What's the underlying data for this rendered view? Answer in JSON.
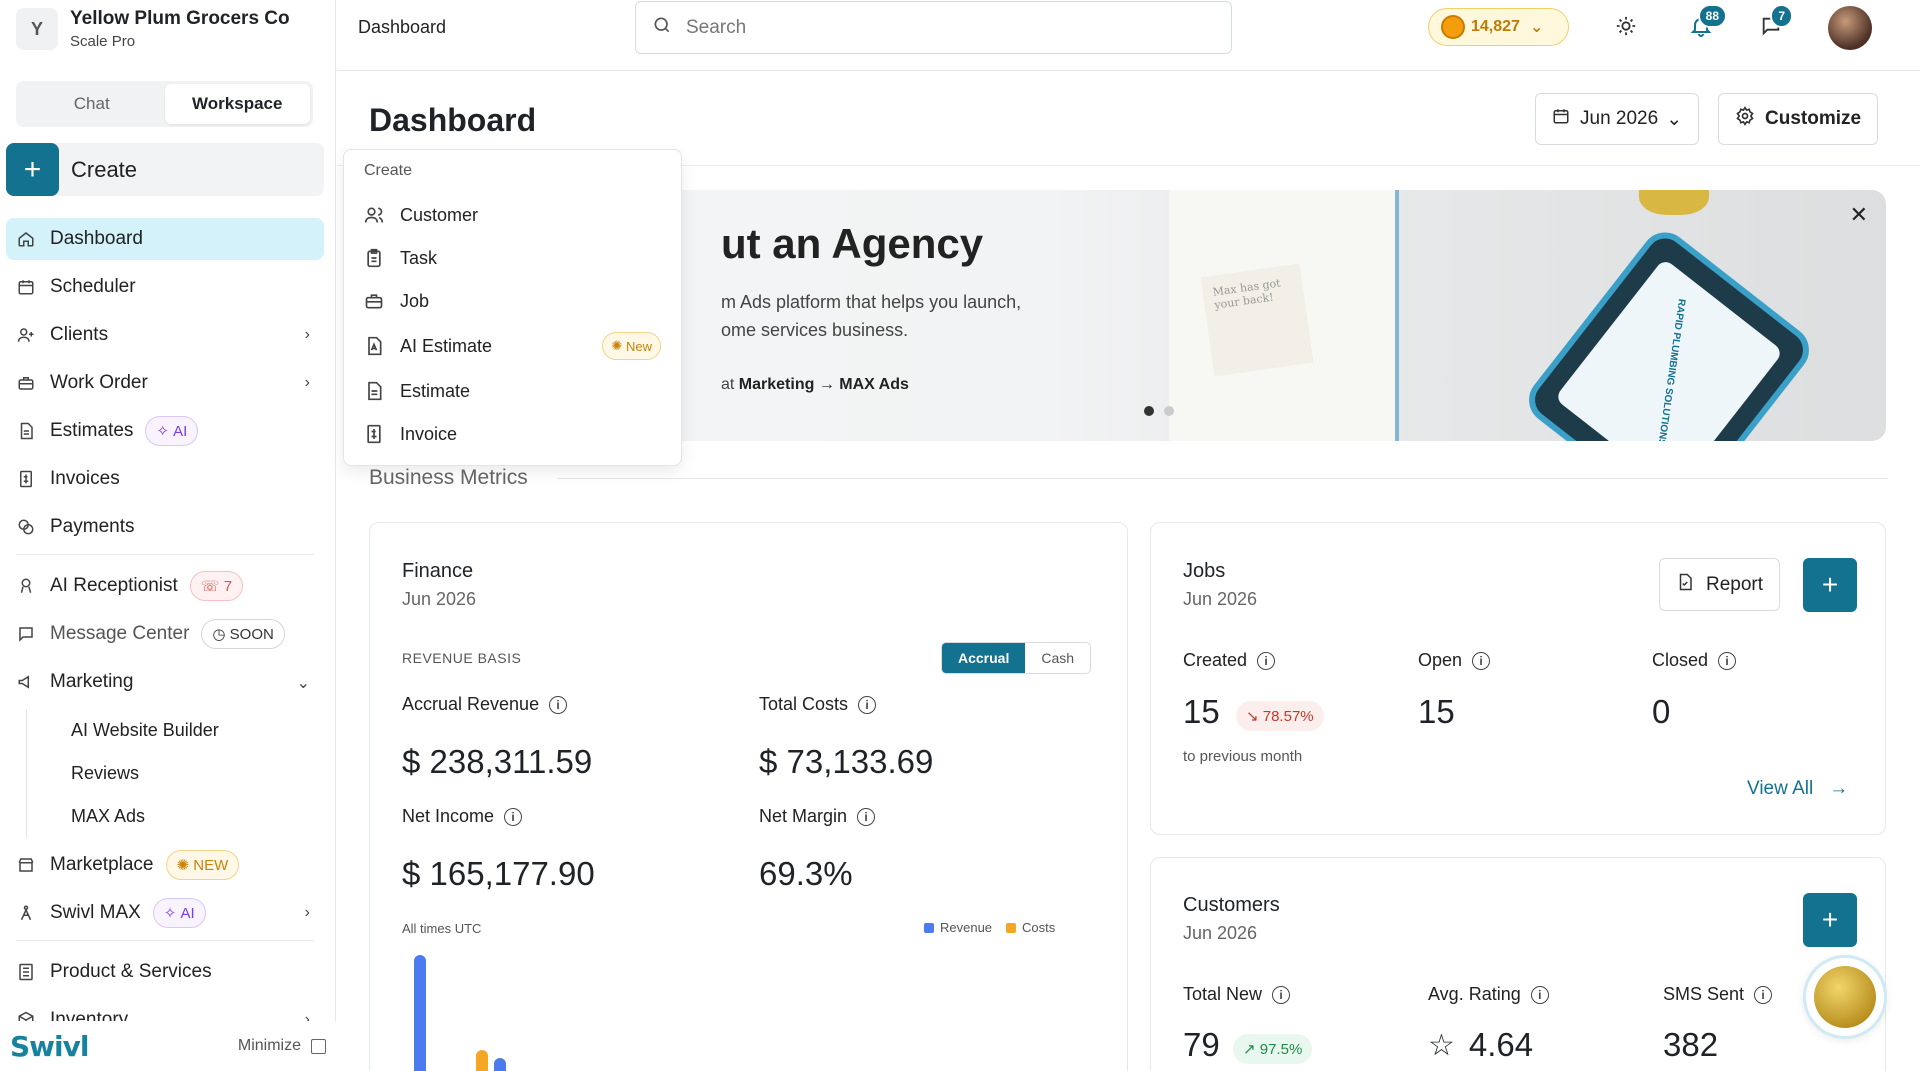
{
  "org": {
    "initial": "Y",
    "name": "Yellow Plum Grocers Co",
    "plan": "Scale Pro"
  },
  "mode_switch": {
    "chat": "Chat",
    "workspace": "Workspace"
  },
  "create_button": {
    "label": "Create"
  },
  "nav": {
    "dashboard": "Dashboard",
    "scheduler": "Scheduler",
    "clients": "Clients",
    "work_order": "Work Order",
    "estimates": "Estimates",
    "estimates_badge": "AI",
    "invoices": "Invoices",
    "payments": "Payments",
    "ai_receptionist": "AI Receptionist",
    "ai_receptionist_badge": "7",
    "message_center": "Message Center",
    "message_center_badge": "SOON",
    "marketing": "Marketing",
    "marketing_sub": [
      "AI Website Builder",
      "Reviews",
      "MAX Ads"
    ],
    "marketplace": "Marketplace",
    "marketplace_badge": "NEW",
    "swivl_max": "Swivl MAX",
    "swivl_max_badge": "AI",
    "product_services": "Product & Services",
    "inventory": "Inventory"
  },
  "footer": {
    "brand": "Swivl",
    "minimize": "Minimize"
  },
  "topbar": {
    "title": "Dashboard",
    "search_placeholder": "Search",
    "coins": "14,827",
    "notifications_count": "88",
    "messages_count": "7"
  },
  "page": {
    "title": "Dashboard",
    "date_filter": "Jun 2026",
    "customize": "Customize"
  },
  "banner": {
    "title": "ut an Agency",
    "text_line1": "m Ads platform that helps you launch,",
    "text_line2": "ome services business.",
    "note_prefix": "at ",
    "note_path": "Marketing → MAX Ads",
    "postit": "Max has got your back!",
    "phone_text": "RAPID PLUMBING SOLUTIONS"
  },
  "create_menu": {
    "header": "Create",
    "items": [
      "Customer",
      "Task",
      "Job",
      "AI Estimate",
      "Estimate",
      "Invoice"
    ],
    "new_badge": "New"
  },
  "metrics_section": {
    "title": "Business Metrics"
  },
  "finance": {
    "title": "Finance",
    "period": "Jun 2026",
    "revenue_basis_label": "REVENUE BASIS",
    "toggle": {
      "accrual": "Accrual",
      "cash": "Cash"
    },
    "accrual_revenue_label": "Accrual Revenue",
    "accrual_revenue": "$ 238,311.59",
    "total_costs_label": "Total Costs",
    "total_costs": "$ 73,133.69",
    "net_income_label": "Net Income",
    "net_income": "$ 165,177.90",
    "net_margin_label": "Net Margin",
    "net_margin": "69.3%",
    "timezone_note": "All times UTC",
    "legend": {
      "revenue": "Revenue",
      "costs": "Costs"
    }
  },
  "jobs": {
    "title": "Jobs",
    "period": "Jun 2026",
    "report": "Report",
    "created_label": "Created",
    "created": "15",
    "created_change": "78.57%",
    "created_caption": "to previous month",
    "open_label": "Open",
    "open": "15",
    "closed_label": "Closed",
    "closed": "0",
    "view_all": "View All"
  },
  "customers": {
    "title": "Customers",
    "period": "Jun 2026",
    "total_new_label": "Total New",
    "total_new": "79",
    "total_new_change": "97.5%",
    "avg_rating_label": "Avg. Rating",
    "avg_rating": "4.64",
    "sms_sent_label": "SMS Sent",
    "sms_sent": "382"
  },
  "colors": {
    "accent": "#13728f",
    "active_nav": "#d4f2fa",
    "revenue": "#4a7cf0",
    "costs": "#f5a623"
  }
}
